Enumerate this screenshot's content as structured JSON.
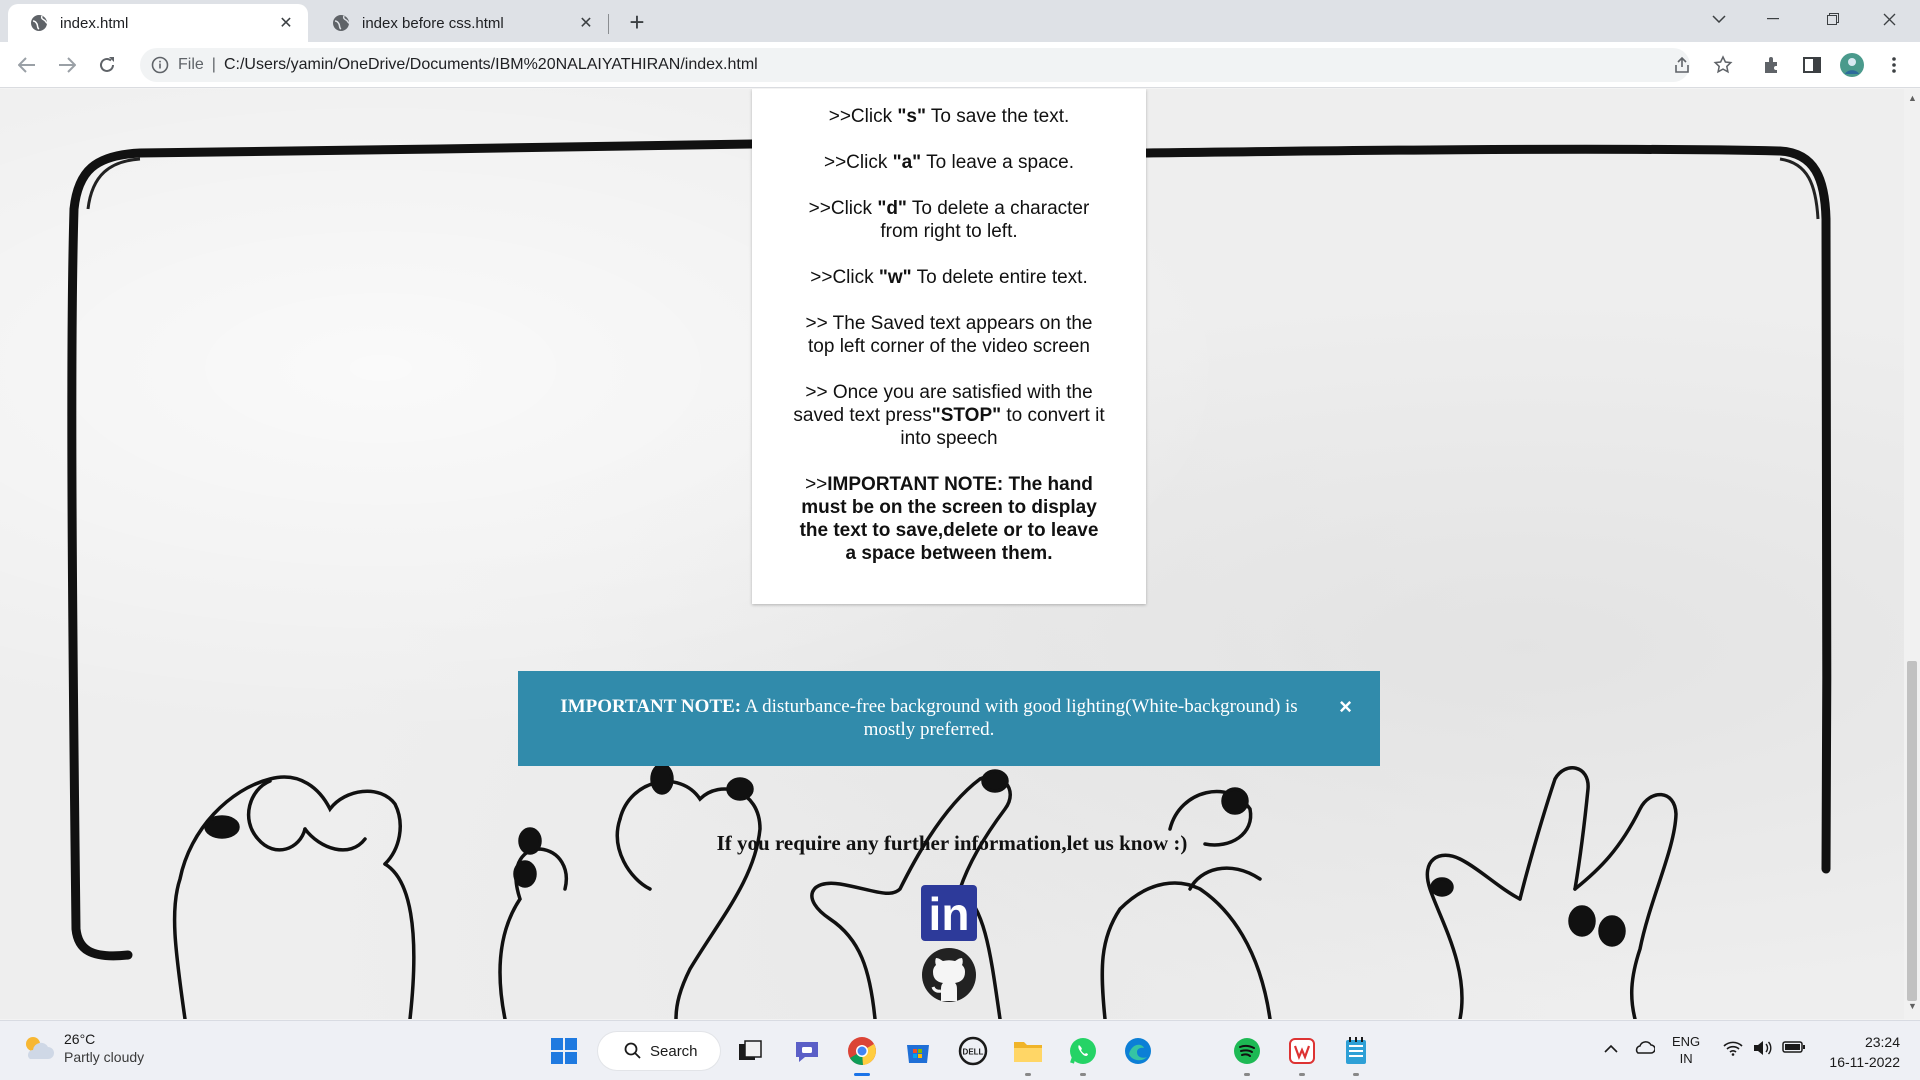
{
  "browser": {
    "tabs": [
      {
        "title": "index.html",
        "active": true
      },
      {
        "title": "index before css.html",
        "active": false
      }
    ],
    "address": {
      "scheme_label": "File",
      "url": "C:/Users/yamin/OneDrive/Documents/IBM%20NALAIYATHIRAN/index.html"
    }
  },
  "page": {
    "instructions": [
      {
        "pre": ">>Click ",
        "key": "\"s\"",
        "post": " To save the text."
      },
      {
        "pre": ">>Click ",
        "key": "\"a\"",
        "post": " To leave a space."
      },
      {
        "pre": ">>Click ",
        "key": "\"d\"",
        "post": " To delete a character from right to left."
      },
      {
        "pre": ">>Click ",
        "key": "\"w\"",
        "post": " To delete entire text."
      },
      {
        "pre": ">> The Saved text appears on the top left corner of the video screen",
        "key": "",
        "post": ""
      },
      {
        "pre": ">> Once you are satisfied with the saved text press",
        "key": "\"STOP\"",
        "post": " to convert it into speech"
      }
    ],
    "important_prefix": ">>",
    "important_note": "IMPORTANT NOTE: The hand must be on the screen to display the text to save,delete or to leave a space between them.",
    "alert": {
      "title": "IMPORTANT NOTE:",
      "message": " A disturbance-free background with good lighting(White-background) is mostly preferred.",
      "close": "×"
    },
    "contact_text": "If you require any further information,let us know :)",
    "social": [
      {
        "name": "LinkedIn",
        "icon": "linkedin-icon",
        "label": "in"
      },
      {
        "name": "GitHub",
        "icon": "github-icon"
      }
    ],
    "colors": {
      "alert_bg": "#318bab",
      "linkedin_bg": "#2d3a9a"
    }
  },
  "taskbar": {
    "weather": {
      "temp": "26°C",
      "condition": "Partly cloudy"
    },
    "search_label": "Search",
    "apps": [
      "file-explorer",
      "teams-chat",
      "chrome",
      "microsoft-store",
      "dell",
      "folder",
      "whatsapp",
      "edge",
      "spotify",
      "wps",
      "notepad"
    ],
    "language": {
      "line1": "ENG",
      "line2": "IN"
    },
    "clock": {
      "time": "23:24",
      "date": "16-11-2022"
    }
  }
}
